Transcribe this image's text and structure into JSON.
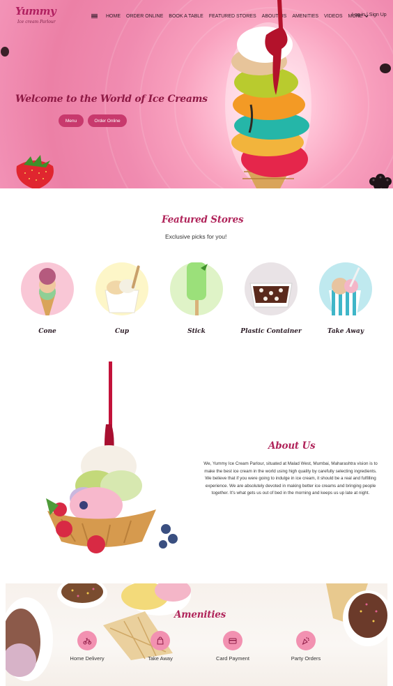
{
  "header": {
    "logo_text": "Yummy",
    "logo_subtext": "Ice cream Parlour",
    "menu_icon": "hamburger-icon",
    "nav": [
      {
        "label": "HOME"
      },
      {
        "label": "ORDER ONLINE"
      },
      {
        "label": "BOOK A TABLE"
      },
      {
        "label": "FEATURED STORES"
      },
      {
        "label": "ABOUT US"
      },
      {
        "label": "AMENITIES"
      },
      {
        "label": "VIDEOS"
      }
    ],
    "more_label": "MORE",
    "auth_label": "Log in | Sign Up"
  },
  "hero": {
    "title": "Welcome to the World of Ice Creams",
    "menu_button": "Menu",
    "order_button": "Order Online"
  },
  "featured": {
    "title": "Featured Stores",
    "subtitle": "Exclusive picks for you!",
    "items": [
      {
        "label": "Cone",
        "bg": "#f9c7d6"
      },
      {
        "label": "Cup",
        "bg": "#fdf6c8"
      },
      {
        "label": "Stick",
        "bg": "#dff3c7"
      },
      {
        "label": "Plastic Container",
        "bg": "#e9e3e6"
      },
      {
        "label": "Take Away",
        "bg": "#bfe9ef"
      }
    ]
  },
  "about": {
    "title": "About Us",
    "body": "We, Yummy Ice Cream Parlour, situated at Malad West, Mumbai, Maharashtra vision is to make the best ice cream in the world using high quality by carefully selecting ingredients. We believe that if you were going to indulge in ice cream, it should be a real and fulfilling experience. We are absolutely devoted in making better ice creams and bringing people together. It's what gets us out of bed in the morning and keeps us up late at night."
  },
  "amenities": {
    "title": "Amenities",
    "items": [
      {
        "label": "Home Delivery",
        "icon": "scooter-icon"
      },
      {
        "label": "Take Away",
        "icon": "takeaway-bag-icon"
      },
      {
        "label": "Card Payment",
        "icon": "credit-card-icon"
      },
      {
        "label": "Party Orders",
        "icon": "party-popper-icon"
      }
    ]
  },
  "colors": {
    "brand": "#b0245a",
    "button": "#c8396d",
    "hero_pink": "#f08bb0",
    "amenity_icon_bg": "#f291b1"
  }
}
